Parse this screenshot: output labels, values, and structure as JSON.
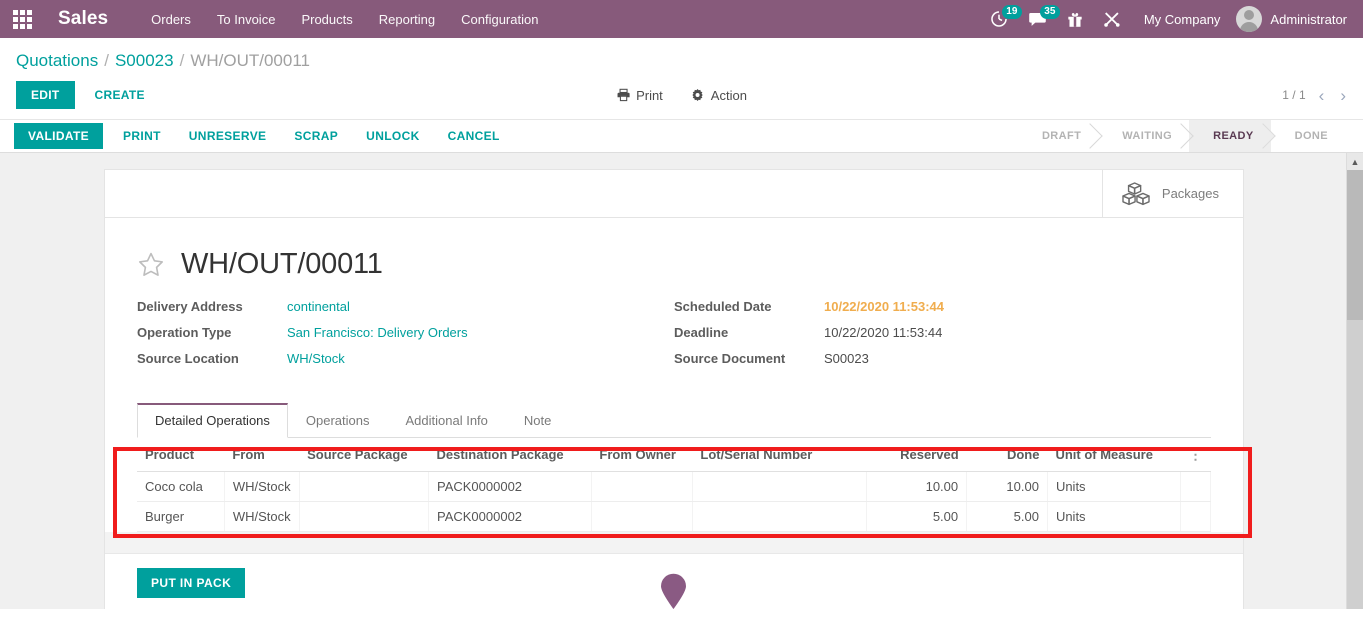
{
  "navbar": {
    "apps_icon": "apps-grid-icon",
    "brand": "Sales",
    "menu": [
      {
        "label": "Orders"
      },
      {
        "label": "To Invoice"
      },
      {
        "label": "Products"
      },
      {
        "label": "Reporting"
      },
      {
        "label": "Configuration"
      }
    ],
    "activity_icon": "clock-activity-icon",
    "activity_count": "19",
    "messages_icon": "chat-bubble-icon",
    "messages_count": "35",
    "gift_icon": "gift-icon",
    "tools_icon": "tools-icon",
    "company": "My Company",
    "user": "Administrator",
    "avatar_icon": "user-avatar-icon",
    "accent": "#875a7b",
    "badge_color": "#00a09d"
  },
  "breadcrumb": {
    "root": "Quotations",
    "parent": "S00023",
    "current": "WH/OUT/00011",
    "separator": "/"
  },
  "controlpanel": {
    "edit_label": "EDIT",
    "create_label": "CREATE",
    "print_label": "Print",
    "print_icon": "printer-icon",
    "action_label": "Action",
    "action_icon": "gear-icon",
    "pager_value": "1 / 1",
    "prev_icon": "chevron-left-icon",
    "next_icon": "chevron-right-icon"
  },
  "statusbar": {
    "buttons": [
      {
        "label": "VALIDATE",
        "primary": true
      },
      {
        "label": "PRINT",
        "primary": false
      },
      {
        "label": "UNRESERVE",
        "primary": false
      },
      {
        "label": "SCRAP",
        "primary": false
      },
      {
        "label": "UNLOCK",
        "primary": false
      },
      {
        "label": "CANCEL",
        "primary": false
      }
    ],
    "stages": [
      {
        "label": "DRAFT",
        "active": false
      },
      {
        "label": "WAITING",
        "active": false
      },
      {
        "label": "READY",
        "active": true
      },
      {
        "label": "DONE",
        "active": false
      }
    ]
  },
  "sheet": {
    "button_box": {
      "packages_label": "Packages",
      "packages_icon": "boxes-icon"
    },
    "star_icon": "star-outline-icon",
    "title": "WH/OUT/00011",
    "fields_left": [
      {
        "label": "Delivery Address",
        "value": "continental",
        "style": "link"
      },
      {
        "label": "Operation Type",
        "value": "San Francisco: Delivery Orders",
        "style": "link"
      },
      {
        "label": "Source Location",
        "value": "WH/Stock",
        "style": "link"
      }
    ],
    "fields_right": [
      {
        "label": "Scheduled Date",
        "value": "10/22/2020 11:53:44",
        "style": "warn"
      },
      {
        "label": "Deadline",
        "value": "10/22/2020 11:53:44",
        "style": "plain"
      },
      {
        "label": "Source Document",
        "value": "S00023",
        "style": "plain"
      }
    ],
    "tabs": [
      {
        "label": "Detailed Operations",
        "active": true
      },
      {
        "label": "Operations",
        "active": false
      },
      {
        "label": "Additional Info",
        "active": false
      },
      {
        "label": "Note",
        "active": false
      }
    ],
    "table": {
      "columns": [
        "Product",
        "From",
        "Source Package",
        "Destination Package",
        "From Owner",
        "Lot/Serial Number",
        "Reserved",
        "Done",
        "Unit of Measure"
      ],
      "optional_columns_icon": "vertical-dots-icon",
      "rows": [
        {
          "product": "Coco cola",
          "from": "WH/Stock",
          "source_package": "",
          "destination_package": "PACK0000002",
          "from_owner": "",
          "lot_serial": "",
          "reserved": "10.00",
          "done": "10.00",
          "uom": "Units"
        },
        {
          "product": "Burger",
          "from": "WH/Stock",
          "source_package": "",
          "destination_package": "PACK0000002",
          "from_owner": "",
          "lot_serial": "",
          "reserved": "5.00",
          "done": "5.00",
          "uom": "Units"
        }
      ]
    },
    "put_in_pack_label": "PUT IN PACK",
    "annotation_color": "#f01c1c"
  },
  "cursor": {
    "marker_icon": "map-pin-marker",
    "color": "#8a5a83"
  }
}
